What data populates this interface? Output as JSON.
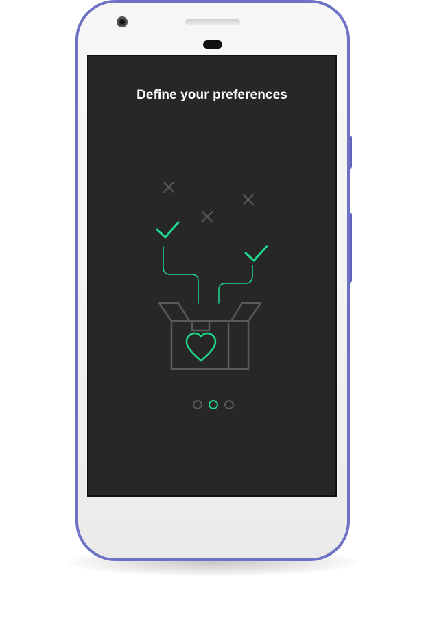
{
  "onboarding": {
    "title": "Define your preferences",
    "page_indicator": {
      "total": 3,
      "active_index": 1
    }
  },
  "icons": {
    "illustration": "open-box-with-heart-illustration",
    "check": "check-icon",
    "cross": "cross-icon",
    "heart": "heart-icon"
  },
  "colors": {
    "device_frame": "#6e72c4",
    "screen_background": "#272727",
    "accent": "#1fd98c",
    "muted_line": "#5a5a5a",
    "title_text": "#ffffff"
  }
}
